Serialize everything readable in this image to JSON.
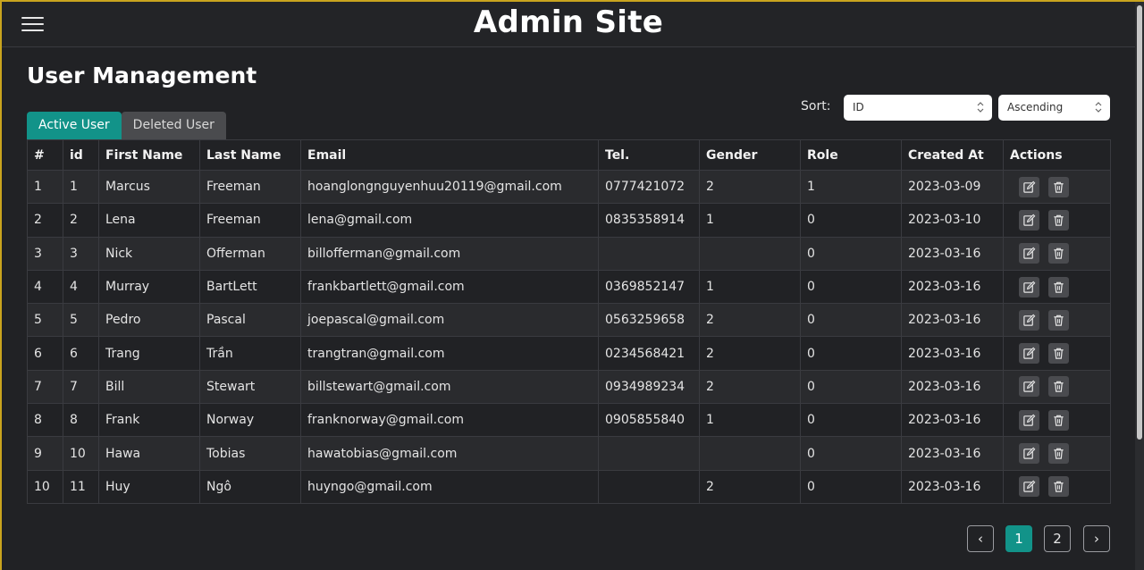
{
  "header": {
    "title": "Admin Site",
    "menu_icon": "hamburger-menu-icon"
  },
  "page": {
    "title": "User Management"
  },
  "tabs": [
    {
      "label": "Active User",
      "active": true
    },
    {
      "label": "Deleted User",
      "active": false
    }
  ],
  "sort": {
    "label": "Sort:",
    "field": "ID",
    "order": "Ascending"
  },
  "table": {
    "columns": [
      "#",
      "id",
      "First Name",
      "Last Name",
      "Email",
      "Tel.",
      "Gender",
      "Role",
      "Created At",
      "Actions"
    ],
    "rows": [
      [
        "1",
        "1",
        "Marcus",
        "Freeman",
        "hoanglongnguyenhuu20119@gmail.com",
        "0777421072",
        "2",
        "1",
        "2023-03-09"
      ],
      [
        "2",
        "2",
        "Lena",
        "Freeman",
        "lena@gmail.com",
        "0835358914",
        "1",
        "0",
        "2023-03-10"
      ],
      [
        "3",
        "3",
        "Nick",
        "Offerman",
        "billofferman@gmail.com",
        "",
        "",
        "0",
        "2023-03-16"
      ],
      [
        "4",
        "4",
        "Murray",
        "BartLett",
        "frankbartlett@gmail.com",
        "0369852147",
        "1",
        "0",
        "2023-03-16"
      ],
      [
        "5",
        "5",
        "Pedro",
        "Pascal",
        "joepascal@gmail.com",
        "0563259658",
        "2",
        "0",
        "2023-03-16"
      ],
      [
        "6",
        "6",
        "Trang",
        "Trần",
        "trangtran@gmail.com",
        "0234568421",
        "2",
        "0",
        "2023-03-16"
      ],
      [
        "7",
        "7",
        "Bill",
        "Stewart",
        "billstewart@gmail.com",
        "0934989234",
        "2",
        "0",
        "2023-03-16"
      ],
      [
        "8",
        "8",
        "Frank",
        "Norway",
        "franknorway@gmail.com",
        "0905855840",
        "1",
        "0",
        "2023-03-16"
      ],
      [
        "9",
        "10",
        "Hawa",
        "Tobias",
        "hawatobias@gmail.com",
        "",
        "",
        "0",
        "2023-03-16"
      ],
      [
        "10",
        "11",
        "Huy",
        "Ngô",
        "huyngo@gmail.com",
        "",
        "2",
        "0",
        "2023-03-16"
      ]
    ],
    "action_icons": [
      "edit-icon",
      "trash-icon"
    ]
  },
  "pagination": {
    "prev": "‹",
    "pages": [
      "1",
      "2"
    ],
    "current": "1",
    "next": "›"
  },
  "colors": {
    "accent": "#129389",
    "background": "#212225",
    "frame": "#c9a41e"
  }
}
